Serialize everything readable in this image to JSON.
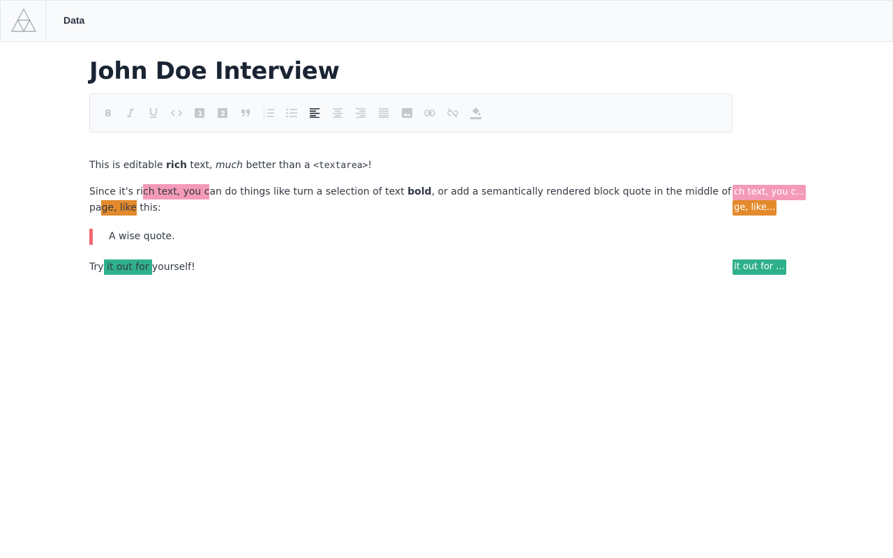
{
  "nav": {
    "item": "Data"
  },
  "page": {
    "title": "John Doe Interview"
  },
  "toolbar": {
    "buttons": [
      {
        "name": "bold-icon"
      },
      {
        "name": "italic-icon"
      },
      {
        "name": "underline-icon"
      },
      {
        "name": "code-icon"
      },
      {
        "name": "heading-one-icon"
      },
      {
        "name": "heading-two-icon"
      },
      {
        "name": "block-quote-icon"
      },
      {
        "name": "numbered-list-icon"
      },
      {
        "name": "bulleted-list-icon"
      },
      {
        "name": "align-left-icon",
        "active": true
      },
      {
        "name": "align-center-icon"
      },
      {
        "name": "align-right-icon"
      },
      {
        "name": "align-justify-icon"
      },
      {
        "name": "image-icon"
      },
      {
        "name": "link-icon"
      },
      {
        "name": "unlink-icon"
      },
      {
        "name": "highlight-icon"
      }
    ],
    "heading_one_label": "1",
    "heading_two_label": "2"
  },
  "editor": {
    "p1": {
      "a": "This is editable ",
      "b": "rich",
      "c": " text, ",
      "d": "much",
      "e": " better than a ",
      "f": "<textarea>",
      "g": "!"
    },
    "p2": {
      "a": "Since it's ri",
      "b": "ch text, you c",
      "c": "an do things like turn a selection of text ",
      "d": "bold",
      "e": ", or add a semantically rendered block quote in the middle of the"
    },
    "p2b": {
      "a": "pa",
      "b": "ge, like",
      "c": " this:"
    },
    "quote": "A wise quote.",
    "p3": {
      "a": "Try",
      "b": " it out for ",
      "c": "yourself!"
    }
  },
  "comments": [
    {
      "text": "ch text, you c...",
      "color": "#f49ab8"
    },
    {
      "text": "ge, like...",
      "color": "#e38a2c"
    },
    {
      "text": "it out for ...",
      "color": "#2fb08a"
    }
  ],
  "colors": {
    "active_icon": "#1a2433",
    "inactive_icon": "#c4c8ce",
    "quote_bar": "#ef6b75"
  }
}
